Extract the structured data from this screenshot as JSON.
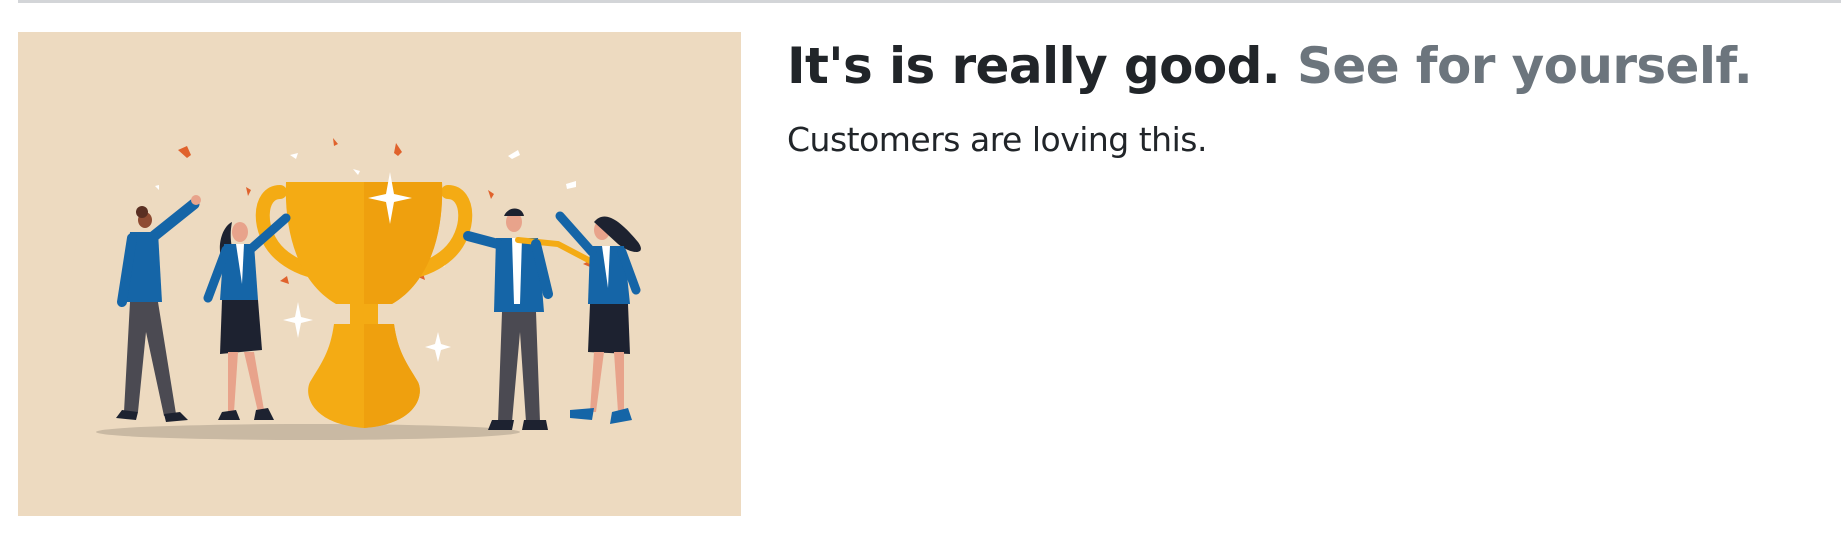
{
  "featurette": {
    "heading_main": "It's is really good.",
    "heading_muted": "See for yourself.",
    "lead": "Customers are loving this.",
    "image": {
      "alt": "",
      "background": "#eddac0",
      "trophy_color": "#f4ab14",
      "jacket_color": "#1565a7",
      "confetti_color": "#e0622c"
    }
  },
  "colors": {
    "heading": "#212529",
    "muted": "#6c757d",
    "rule": "#d3d5d8"
  }
}
